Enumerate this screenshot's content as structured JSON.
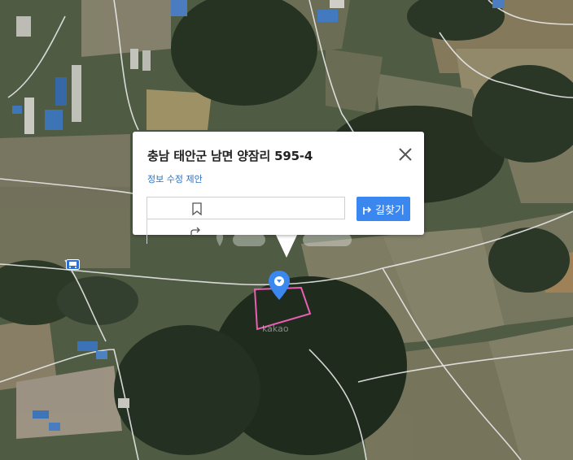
{
  "popup": {
    "address": "충남 태안군 남면 양잠리 595-4",
    "suggest_link": "정보 수정 제안",
    "route_button": "길찾기"
  },
  "map": {
    "kakao_watermark": "kakao",
    "parcel_outline_color": "#e85fb3",
    "marker_color": "#3a87f0"
  },
  "icons": {
    "close": "close-icon",
    "bookmark": "bookmark-icon",
    "share": "share-icon",
    "route": "route-icon",
    "bus": "bus-stop-icon",
    "marker": "location-marker-icon"
  }
}
